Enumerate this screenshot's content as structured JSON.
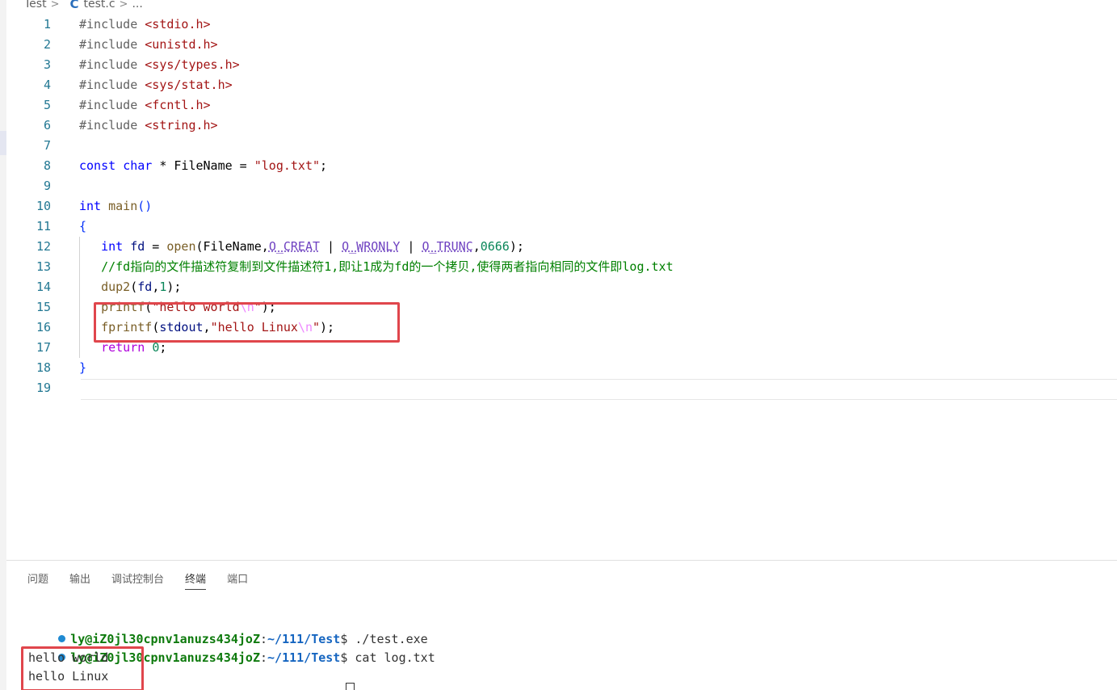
{
  "breadcrumb": {
    "folder": "Test",
    "sep": ">",
    "file_icon": "C",
    "file": "test.c",
    "tail": "..."
  },
  "editor": {
    "language": "c",
    "lines": [
      {
        "n": "1"
      },
      {
        "n": "2"
      },
      {
        "n": "3"
      },
      {
        "n": "4"
      },
      {
        "n": "5"
      },
      {
        "n": "6"
      },
      {
        "n": "7"
      },
      {
        "n": "8"
      },
      {
        "n": "9"
      },
      {
        "n": "10"
      },
      {
        "n": "11"
      },
      {
        "n": "12"
      },
      {
        "n": "13"
      },
      {
        "n": "14"
      },
      {
        "n": "15"
      },
      {
        "n": "16"
      },
      {
        "n": "17"
      },
      {
        "n": "18"
      },
      {
        "n": "19"
      }
    ],
    "code": {
      "l1": [
        "#include ",
        "<stdio.h>"
      ],
      "l2": [
        "#include ",
        "<unistd.h>"
      ],
      "l3": [
        "#include ",
        "<sys/types.h>"
      ],
      "l4": [
        "#include ",
        "<sys/stat.h>"
      ],
      "l5": [
        "#include ",
        "<fcntl.h>"
      ],
      "l6": [
        "#include ",
        "<string.h>"
      ],
      "l8": [
        "const",
        " ",
        "char",
        " * ",
        "FileName",
        " = ",
        "\"log.txt\"",
        ";"
      ],
      "l10": [
        "int",
        " ",
        "main",
        "()"
      ],
      "l11": [
        "{"
      ],
      "l12": [
        "   ",
        "int",
        " ",
        "fd",
        " = ",
        "open",
        "(",
        "FileName",
        ",",
        "O_CREAT",
        " | ",
        "O_WRONLY",
        " | ",
        "O_TRUNC",
        ",",
        "0666",
        ");"
      ],
      "l13": [
        "   ",
        "//fd指向的文件描述符复制到文件描述符1,即让1成为fd的一个拷贝,使得两者指向相同的文件即log.txt"
      ],
      "l14": [
        "   ",
        "dup2",
        "(",
        "fd",
        ",",
        "1",
        ");"
      ],
      "l15": [
        "   ",
        "printf",
        "(",
        "\"hello world",
        "\\n",
        "\"",
        ");"
      ],
      "l16": [
        "   ",
        "fprintf",
        "(",
        "stdout",
        ",",
        "\"hello Linux",
        "\\n",
        "\"",
        ");"
      ],
      "l17": [
        "   ",
        "return",
        " ",
        "0",
        ";"
      ],
      "l18": [
        "}"
      ]
    }
  },
  "panel": {
    "tabs": [
      "问题",
      "输出",
      "调试控制台",
      "终端",
      "端口"
    ],
    "active_tab": "终端",
    "terminal": {
      "line1": {
        "user": "ly@iZ0jl30cpnv1anuzs434joZ",
        "colon": ":",
        "path": "~/111/Test",
        "prompt": "$ ",
        "cmd": "./test.exe"
      },
      "line2": {
        "user": "ly@iZ0jl30cpnv1anuzs434joZ",
        "colon": ":",
        "path": "~/111/Test",
        "prompt": "$ ",
        "cmd": "cat log.txt"
      },
      "output": [
        "hello world",
        "hello Linux"
      ]
    }
  },
  "colors": {
    "highlight_box": "#e0464c",
    "line_number": "#237893",
    "terminal_dot": "#1f8ad2"
  }
}
